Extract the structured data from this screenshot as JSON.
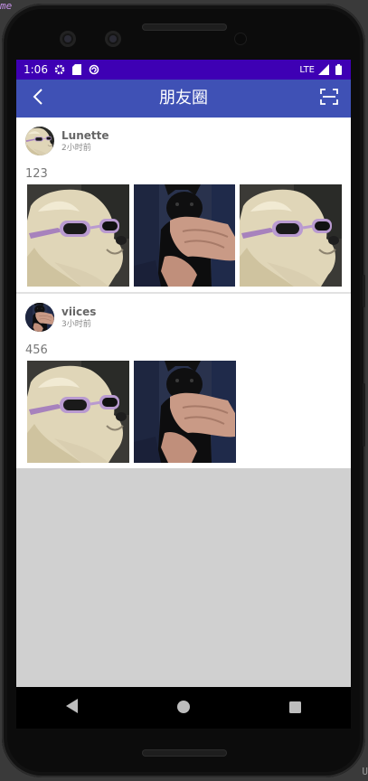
{
  "ide": {
    "corner_label": "me",
    "bottom_right": "U"
  },
  "status_bar": {
    "time": "1:06",
    "network": "LTE",
    "icons": [
      "settings-icon",
      "sim-card-icon",
      "sync-icon",
      "signal-icon",
      "battery-icon"
    ]
  },
  "app_bar": {
    "title": "朋友圈",
    "back_icon": "chevron-left-icon",
    "scan_icon": "scan-icon"
  },
  "posts": [
    {
      "author": "Lunette",
      "time": "2小时前",
      "content": "123",
      "photos": [
        "dog-with-sunglasses",
        "person-holding-black-cat",
        "dog-with-sunglasses"
      ]
    },
    {
      "author": "viices",
      "time": "3小时前",
      "content": "456",
      "photos": [
        "dog-with-sunglasses",
        "person-holding-black-cat"
      ]
    }
  ],
  "nav_bar": {
    "icons": [
      "back-triangle-icon",
      "home-circle-icon",
      "recents-square-icon"
    ]
  },
  "colors": {
    "status_bar": "#3e00b4",
    "app_bar": "#3f51b5",
    "empty_area": "#d0d0d0"
  }
}
